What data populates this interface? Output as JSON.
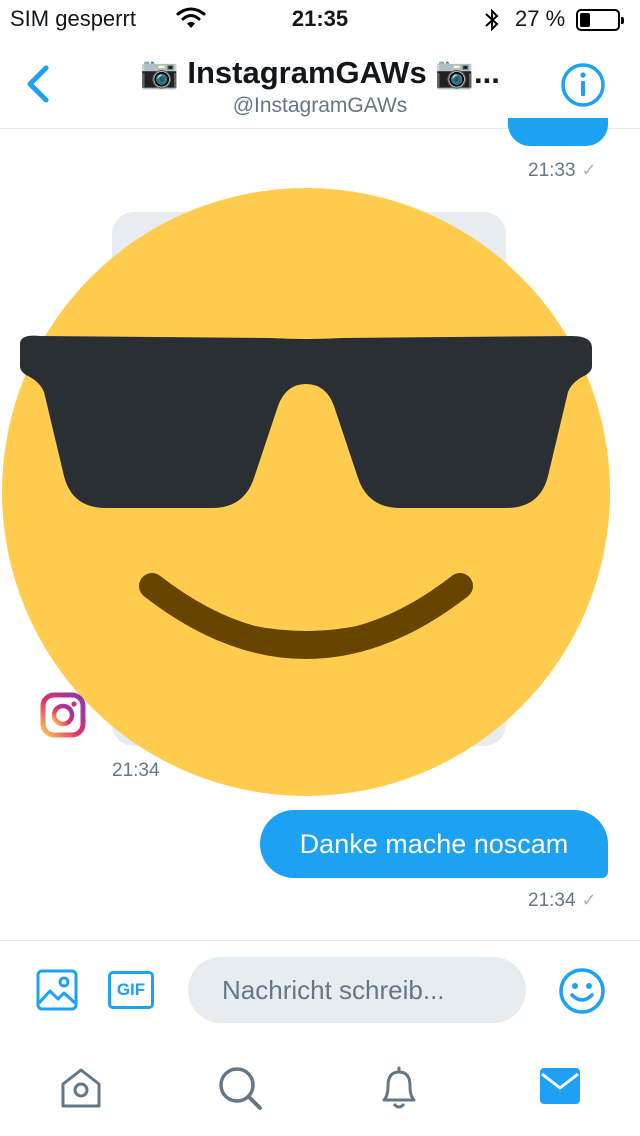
{
  "status_bar": {
    "carrier": "SIM gesperrt",
    "time": "21:35",
    "battery_percent": "27 %",
    "battery_level": 0.27
  },
  "header": {
    "title": "📷 InstagramGAWs 📷...",
    "handle": "@InstagramGAWs",
    "back_icon": "chevron-left-icon",
    "info_icon": "info-icon"
  },
  "messages": [
    {
      "direction": "outgoing",
      "text": "",
      "time": "21:33",
      "status": "✓"
    },
    {
      "direction": "incoming",
      "media": "sunglasses-smiley-emoji",
      "time": "21:34"
    },
    {
      "direction": "outgoing",
      "text": "Danke mache noscam",
      "time": "21:34",
      "status": "✓"
    }
  ],
  "composer": {
    "placeholder": "Nachricht schreib...",
    "gif_label": "GIF",
    "photo_icon": "image-icon",
    "emoji_icon": "smiley-icon"
  },
  "tabs": [
    {
      "name": "home",
      "icon": "home-icon"
    },
    {
      "name": "search",
      "icon": "search-icon"
    },
    {
      "name": "notifications",
      "icon": "bell-icon"
    },
    {
      "name": "messages",
      "icon": "mail-icon",
      "active": true
    }
  ],
  "colors": {
    "accent": "#1da1f2",
    "muted": "#657786",
    "bubble_in": "#e6ecf0",
    "tab_inactive": "#657786"
  }
}
